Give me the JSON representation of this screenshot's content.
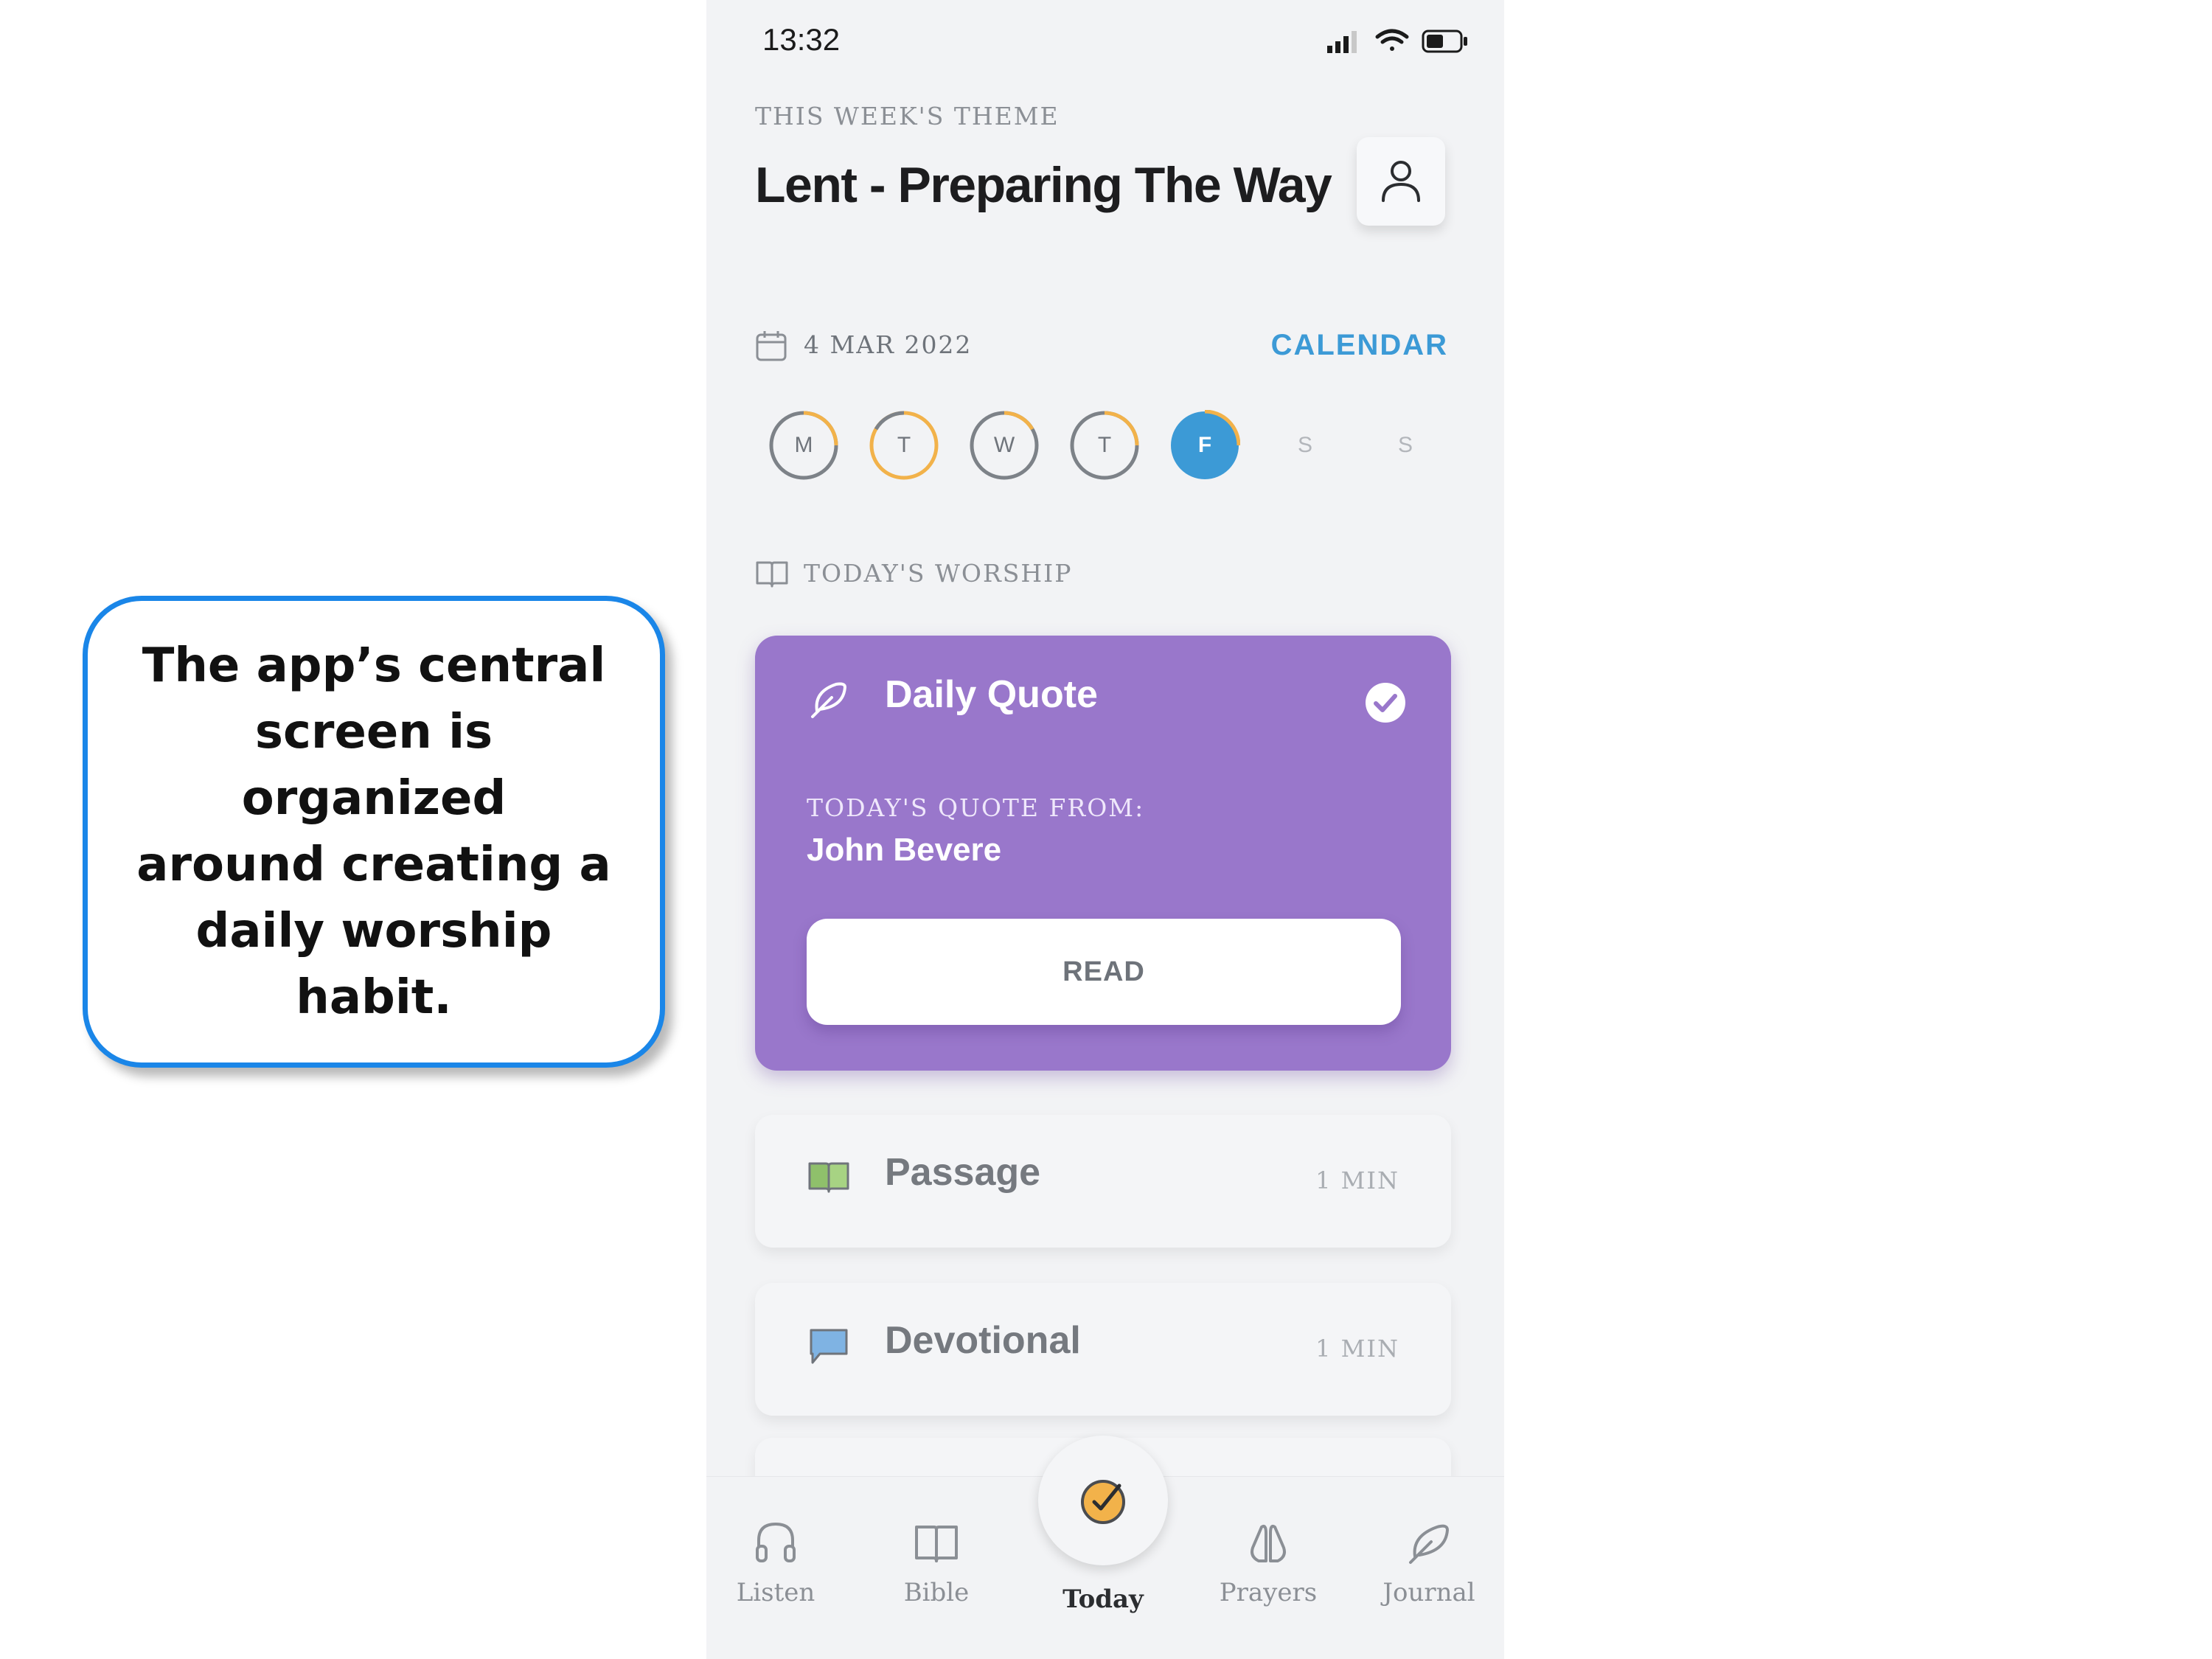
{
  "callout": {
    "line1": "The app’s central",
    "line2": "screen is organized",
    "line3": "around creating a",
    "line4": "daily worship habit."
  },
  "status_bar": {
    "time": "13:32"
  },
  "header": {
    "eyebrow": "THIS WEEK'S THEME",
    "title": "Lent - Preparing The Way"
  },
  "date_row": {
    "date": "4 MAR 2022",
    "calendar_link": "CALENDAR"
  },
  "week": {
    "days": [
      "M",
      "T",
      "W",
      "T",
      "F",
      "S",
      "S"
    ],
    "selected_index": 4
  },
  "section": {
    "label": "TODAY'S WORSHIP"
  },
  "daily_quote": {
    "title": "Daily Quote",
    "eyebrow": "TODAY'S QUOTE FROM:",
    "author": "John Bevere",
    "button": "READ",
    "completed": true
  },
  "items": [
    {
      "title": "Passage",
      "duration": "1 MIN",
      "icon": "open-book-icon"
    },
    {
      "title": "Devotional",
      "duration": "1 MIN",
      "icon": "speech-bubble-icon"
    }
  ],
  "tabs": [
    {
      "label": "Listen",
      "icon": "headphones-icon"
    },
    {
      "label": "Bible",
      "icon": "book-icon"
    },
    {
      "label": "Today",
      "icon": "check-circle-icon",
      "active": true
    },
    {
      "label": "Prayers",
      "icon": "praying-hands-icon"
    },
    {
      "label": "Journal",
      "icon": "feather-icon"
    }
  ],
  "colors": {
    "accent_blue": "#3c9ad6",
    "card_purple": "#9977cb",
    "progress_orange": "#f2b24a",
    "callout_border": "#1a86e8"
  }
}
